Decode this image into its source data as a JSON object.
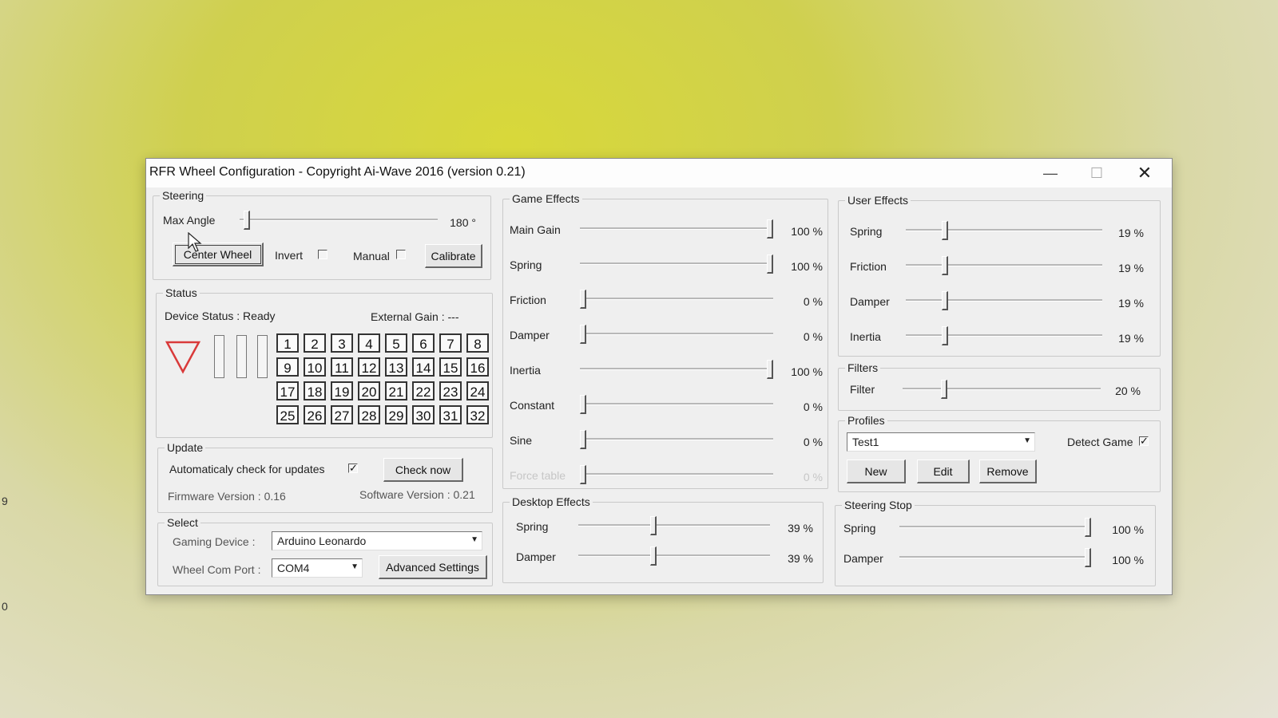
{
  "window": {
    "title": "RFR Wheel Configuration - Copyright Ai-Wave 2016 (version 0.21)",
    "controls": [
      "minimize",
      "maximize",
      "close"
    ]
  },
  "edge_fragments": [
    "9",
    "0"
  ],
  "steering": {
    "legend": "Steering",
    "max_angle_label": "Max Angle",
    "max_angle_value": "180 °",
    "max_angle_slider_level": 0.02,
    "center_wheel_label": "Center Wheel",
    "invert_label": "Invert",
    "invert_checked": false,
    "manual_label": "Manual",
    "manual_checked": false,
    "calibrate_label": "Calibrate"
  },
  "status": {
    "legend": "Status",
    "device_status": "Device Status :  Ready",
    "external_gain": "External Gain :  ---",
    "indicator_color": "#d93a3a",
    "buttons": [
      "1",
      "2",
      "3",
      "4",
      "5",
      "6",
      "7",
      "8",
      "9",
      "10",
      "11",
      "12",
      "13",
      "14",
      "15",
      "16",
      "17",
      "18",
      "19",
      "20",
      "21",
      "22",
      "23",
      "24",
      "25",
      "26",
      "27",
      "28",
      "29",
      "30",
      "31",
      "32"
    ]
  },
  "update": {
    "legend": "Update",
    "auto_check_label": "Automaticaly check for updates",
    "auto_check_checked": true,
    "check_now_label": "Check now",
    "firmware_version": "Firmware Version :  0.16",
    "software_version": "Software Version :   0.21"
  },
  "select": {
    "legend": "Select",
    "gaming_device_label": "Gaming Device :",
    "gaming_device_value": "Arduino Leonardo",
    "com_port_label": "Wheel Com Port :",
    "com_port_value": "COM4",
    "advanced_settings_label": "Advanced Settings"
  },
  "game_effects": {
    "legend": "Game Effects",
    "items": [
      {
        "label": "Main Gain",
        "value": "100 %",
        "level": 1.0,
        "enabled": true
      },
      {
        "label": "Spring",
        "value": "100 %",
        "level": 1.0,
        "enabled": true
      },
      {
        "label": "Friction",
        "value": "0 %",
        "level": 0.0,
        "enabled": true
      },
      {
        "label": "Damper",
        "value": "0 %",
        "level": 0.0,
        "enabled": true
      },
      {
        "label": "Inertia",
        "value": "100 %",
        "level": 1.0,
        "enabled": true
      },
      {
        "label": "Constant",
        "value": "0 %",
        "level": 0.0,
        "enabled": true
      },
      {
        "label": "Sine",
        "value": "0 %",
        "level": 0.0,
        "enabled": true
      },
      {
        "label": "Force table",
        "value": "0 %",
        "level": 0.0,
        "enabled": false
      }
    ]
  },
  "desktop_effects": {
    "legend": "Desktop Effects",
    "items": [
      {
        "label": "Spring",
        "value": "39 %",
        "level": 0.39
      },
      {
        "label": "Damper",
        "value": "39 %",
        "level": 0.39
      }
    ]
  },
  "user_effects": {
    "legend": "User Effects",
    "items": [
      {
        "label": "Spring",
        "value": "19 %",
        "level": 0.19
      },
      {
        "label": "Friction",
        "value": "19 %",
        "level": 0.19
      },
      {
        "label": "Damper",
        "value": "19 %",
        "level": 0.19
      },
      {
        "label": "Inertia",
        "value": "19 %",
        "level": 0.19
      }
    ]
  },
  "filters": {
    "legend": "Filters",
    "filter_label": "Filter",
    "filter_value": "20 %",
    "filter_level": 0.2
  },
  "profiles": {
    "legend": "Profiles",
    "selected": "Test1",
    "detect_game_label": "Detect Game",
    "detect_game_checked": true,
    "new_label": "New",
    "edit_label": "Edit",
    "remove_label": "Remove"
  },
  "steering_stop": {
    "legend": "Steering Stop",
    "items": [
      {
        "label": "Spring",
        "value": "100 %",
        "level": 1.0
      },
      {
        "label": "Damper",
        "value": "100 %",
        "level": 1.0
      }
    ]
  }
}
